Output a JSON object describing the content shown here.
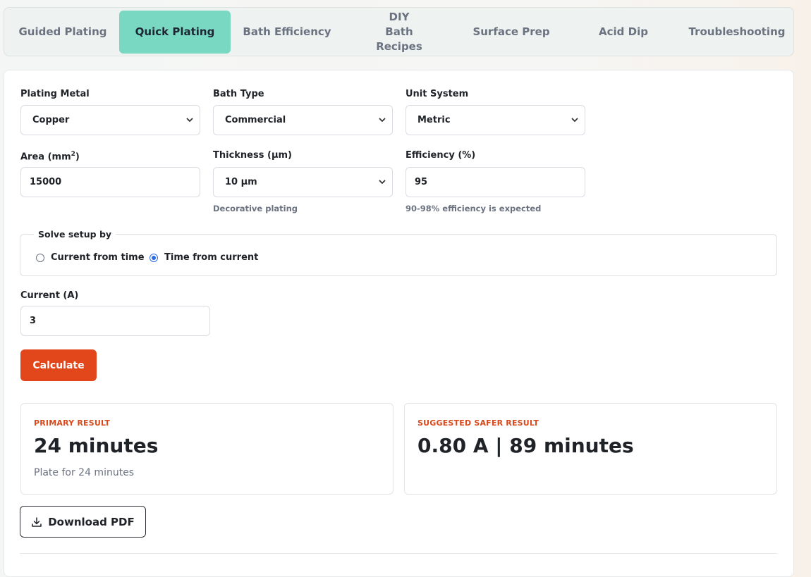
{
  "tabs": [
    {
      "label": "Guided Plating"
    },
    {
      "label": "Quick Plating",
      "active": true
    },
    {
      "label": "Bath Efficiency"
    },
    {
      "label": "DIY Bath Recipes"
    },
    {
      "label": "Surface Prep"
    },
    {
      "label": "Acid Dip"
    },
    {
      "label": "Troubleshooting"
    }
  ],
  "form": {
    "plating_metal": {
      "label": "Plating Metal",
      "value": "Copper"
    },
    "bath_type": {
      "label": "Bath Type",
      "value": "Commercial"
    },
    "unit_system": {
      "label": "Unit System",
      "value": "Metric"
    },
    "area": {
      "label": "Area (mm",
      "label_sup": "2",
      "label_end": ")",
      "value": "15000"
    },
    "thickness": {
      "label": "Thickness (µm)",
      "value": "10 µm",
      "hint": "Decorative plating"
    },
    "efficiency": {
      "label": "Efficiency (%)",
      "value": "95",
      "hint": "90-98% efficiency is expected"
    },
    "solve": {
      "legend": "Solve setup by",
      "options": [
        {
          "label": "Current from time",
          "checked": false
        },
        {
          "label": "Time from current",
          "checked": true
        }
      ]
    },
    "current": {
      "label": "Current (A)",
      "value": "3"
    },
    "calculate_label": "Calculate"
  },
  "results": {
    "primary": {
      "kicker": "PRIMARY RESULT",
      "value": "24 minutes",
      "sub": "Plate for 24 minutes"
    },
    "safer": {
      "kicker": "SUGGESTED SAFER RESULT",
      "value": "0.80 A | 89 minutes"
    }
  },
  "download_label": "Download PDF",
  "icons": {
    "download": "download-icon",
    "chevron": "chevron-down-icon"
  },
  "colors": {
    "tab_active": "#78d8c2",
    "accent": "#e2471c",
    "kicker": "#d9481b",
    "radio": "#2e6be6"
  }
}
